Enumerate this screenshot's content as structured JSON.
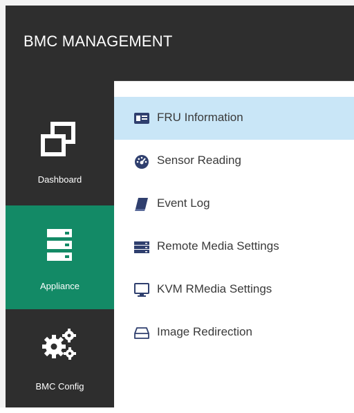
{
  "header": {
    "title": "BMC MANAGEMENT"
  },
  "sidebar": {
    "items": [
      {
        "label": "Dashboard",
        "icon": "dashboard-icon",
        "active": false
      },
      {
        "label": "Appliance",
        "icon": "appliance-icon",
        "active": true
      },
      {
        "label": "BMC Config",
        "icon": "gears-icon",
        "active": false
      }
    ]
  },
  "submenu": {
    "items": [
      {
        "label": "FRU Information",
        "icon": "id-card-icon",
        "active": true
      },
      {
        "label": "Sensor Reading",
        "icon": "gauge-icon",
        "active": false
      },
      {
        "label": "Event Log",
        "icon": "book-icon",
        "active": false
      },
      {
        "label": "Remote Media Settings",
        "icon": "server-rack-icon",
        "active": false
      },
      {
        "label": "KVM RMedia Settings",
        "icon": "monitor-icon",
        "active": false
      },
      {
        "label": "Image Redirection",
        "icon": "hdd-icon",
        "active": false
      }
    ]
  },
  "colors": {
    "header_bg": "#2e2e2e",
    "sidebar_bg": "#2e2e2e",
    "active_nav": "#138a66",
    "active_submenu": "#c9e6f7",
    "icon_blue": "#2f3f6e"
  }
}
